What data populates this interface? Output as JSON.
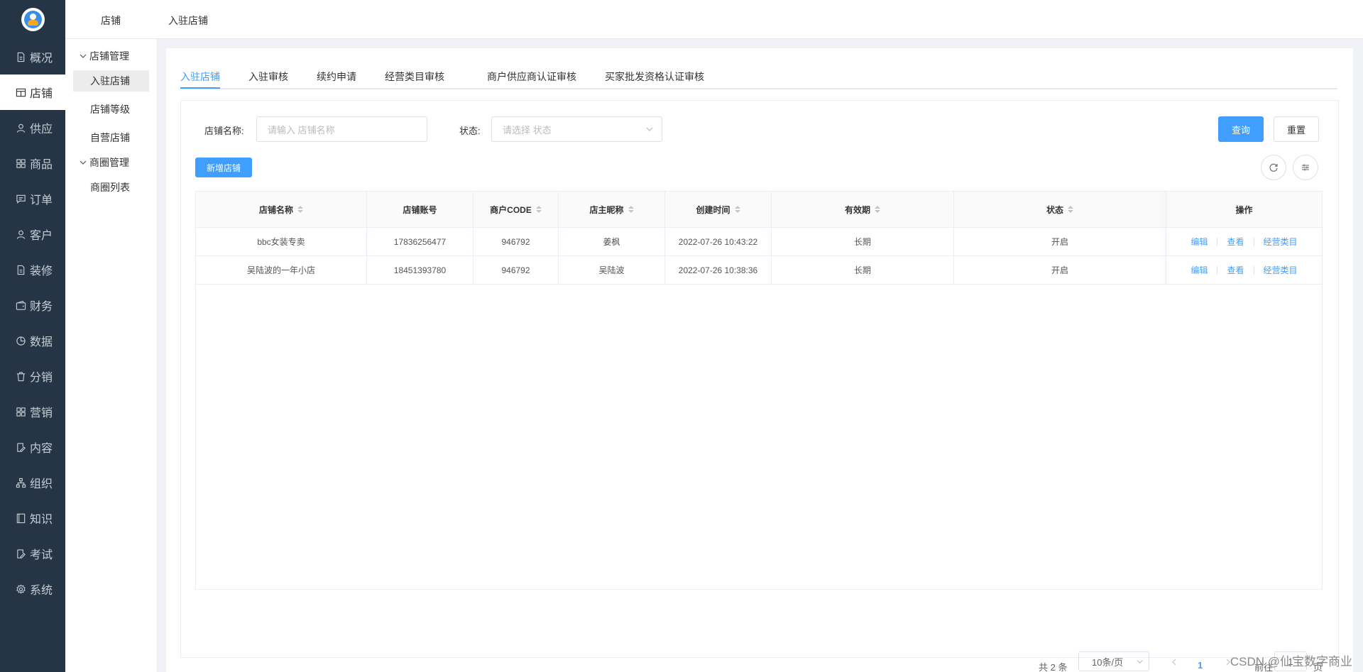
{
  "nav": {
    "items": [
      {
        "label": "概况",
        "icon": "document-icon"
      },
      {
        "label": "店铺",
        "icon": "store-icon"
      },
      {
        "label": "供应",
        "icon": "user-icon"
      },
      {
        "label": "商品",
        "icon": "grid-icon"
      },
      {
        "label": "订单",
        "icon": "message-icon"
      },
      {
        "label": "客户",
        "icon": "user-icon"
      },
      {
        "label": "装修",
        "icon": "document-icon"
      },
      {
        "label": "财务",
        "icon": "wallet-icon"
      },
      {
        "label": "数据",
        "icon": "chart-icon"
      },
      {
        "label": "分销",
        "icon": "trash-icon"
      },
      {
        "label": "营销",
        "icon": "grid-icon"
      },
      {
        "label": "内容",
        "icon": "edit-icon"
      },
      {
        "label": "组织",
        "icon": "org-icon"
      },
      {
        "label": "知识",
        "icon": "book-icon"
      },
      {
        "label": "考试",
        "icon": "edit-icon"
      },
      {
        "label": "系统",
        "icon": "gear-icon"
      }
    ],
    "active_index": 1
  },
  "topbar": {
    "tabs": [
      "店铺",
      "入驻店铺"
    ]
  },
  "submenu": {
    "groups": [
      {
        "label": "店铺管理",
        "items": [
          "入驻店铺",
          "店铺等级",
          "自营店铺"
        ]
      },
      {
        "label": "商圈管理",
        "items": [
          "商圈列表"
        ]
      }
    ],
    "active_item": "入驻店铺"
  },
  "tabs": [
    "入驻店铺",
    "入驻审核",
    "续约申请",
    "经营类目审核",
    "商户供应商认证审核",
    "买家批发资格认证审核"
  ],
  "filters": {
    "shop_name_label": "店铺名称:",
    "shop_name_placeholder": "请输入 店铺名称",
    "status_label": "状态:",
    "status_placeholder": "请选择 状态",
    "query_label": "查询",
    "reset_label": "重置"
  },
  "toolbar": {
    "add_label": "新增店铺"
  },
  "table": {
    "columns": [
      "店铺名称",
      "店铺账号",
      "商户CODE",
      "店主昵称",
      "创建时间",
      "有效期",
      "状态",
      "操作"
    ],
    "rows": [
      {
        "name": "bbc女装专卖",
        "account": "17836256477",
        "code": "946792",
        "owner": "姜枫",
        "created": "2022-07-26 10:43:22",
        "validity": "长期",
        "status": "开启"
      },
      {
        "name": "吴陆波的一年小店",
        "account": "18451393780",
        "code": "946792",
        "owner": "吴陆波",
        "created": "2022-07-26 10:38:36",
        "validity": "长期",
        "status": "开启"
      }
    ],
    "actions": [
      "编辑",
      "查看",
      "经营类目"
    ]
  },
  "pager": {
    "total": "共 2 条",
    "page_size": "10条/页",
    "current": "1",
    "goto_label": "前往",
    "goto_value": "1",
    "page_suffix": "页"
  },
  "watermark": "CSDN @仙宝数字商业"
}
